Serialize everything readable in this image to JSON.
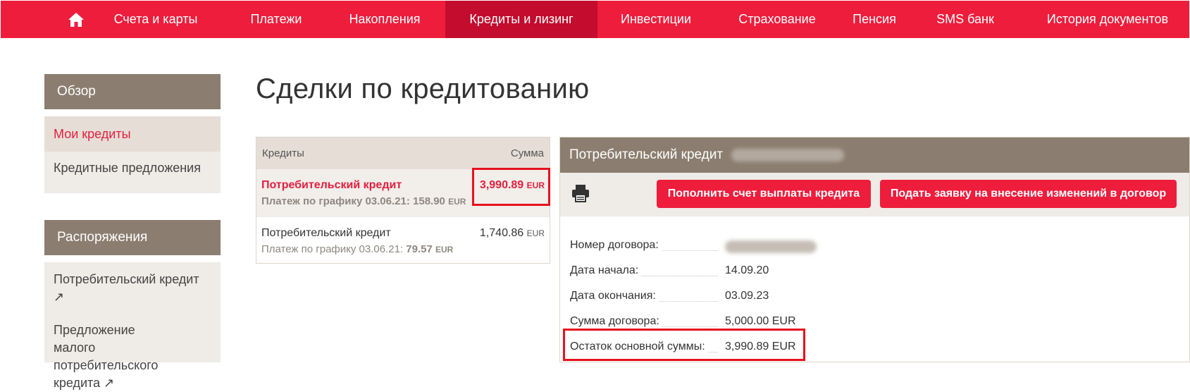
{
  "topnav": {
    "home_icon": "home-icon",
    "items": [
      {
        "label": "Счета и карты"
      },
      {
        "label": "Платежи"
      },
      {
        "label": "Накопления"
      },
      {
        "label": "Кредиты и лизинг"
      },
      {
        "label": "Инвестиции"
      },
      {
        "label": "Страхование"
      },
      {
        "label": "Пенсия"
      },
      {
        "label": "SMS банк"
      },
      {
        "label": "История документов"
      }
    ],
    "active_index": 3
  },
  "sidebar": {
    "sections": [
      {
        "title": "Обзор",
        "items": [
          {
            "label": "Мои кредиты",
            "active": true
          },
          {
            "label": "Кредитные предложения"
          }
        ]
      },
      {
        "title": "Распоряжения",
        "items": [
          {
            "label": "Потребительский кредит ↗"
          },
          {
            "label": "Предложение малого потребительского кредита ↗"
          }
        ]
      }
    ]
  },
  "page_title": "Сделки по кредитованию",
  "credits_table": {
    "col_credits": "Кредиты",
    "col_sum": "Сумма",
    "rows": [
      {
        "name": "Потребительский кредит",
        "schedule_label": "Платеж по графику 03.06.21:",
        "schedule_amount": "158.90",
        "schedule_currency": "EUR",
        "amount": "3,990.89",
        "currency": "EUR",
        "active": true
      },
      {
        "name": "Потребительский кредит",
        "schedule_label": "Платеж по графику 03.06.21:",
        "schedule_amount": "79.57",
        "schedule_currency": "EUR",
        "amount": "1,740.86",
        "currency": "EUR",
        "active": false
      }
    ]
  },
  "detail": {
    "title": "Потребительский кредит",
    "print_icon": "printer-icon",
    "buttons": {
      "topup": "Пополнить счет выплаты кредита",
      "change_request": "Подать заявку на внесение изменений в договор"
    },
    "fields": [
      {
        "label": "Номер договора:",
        "value": ""
      },
      {
        "label": "Дата начала:",
        "value": "14.09.20"
      },
      {
        "label": "Дата окончания:",
        "value": "03.09.23"
      },
      {
        "label": "Сумма договора:",
        "value": "5,000.00 EUR"
      },
      {
        "label": "Остаток основной суммы:",
        "value": "3,990.89 EUR"
      }
    ]
  },
  "colors": {
    "brand_red": "#ee1d3c",
    "nav_active": "#c30c2e",
    "panel_header": "#8b7e70",
    "panel_bg": "#efebe6",
    "highlight_border": "#e6111e"
  }
}
